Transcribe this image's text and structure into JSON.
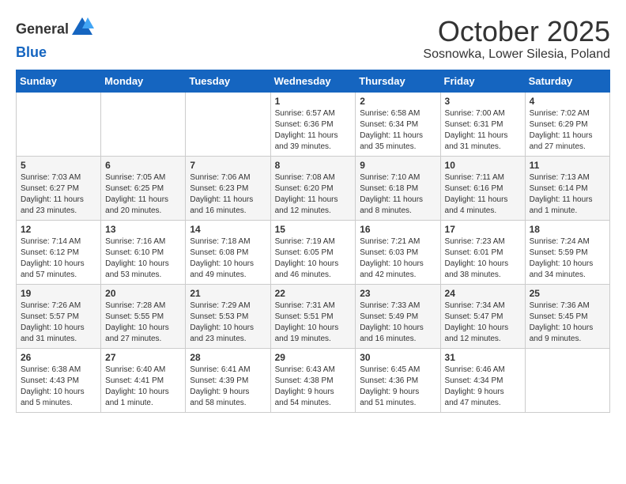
{
  "header": {
    "logo_line1": "General",
    "logo_line2": "Blue",
    "month_title": "October 2025",
    "location": "Sosnowka, Lower Silesia, Poland"
  },
  "days_of_week": [
    "Sunday",
    "Monday",
    "Tuesday",
    "Wednesday",
    "Thursday",
    "Friday",
    "Saturday"
  ],
  "weeks": [
    [
      {
        "day": "",
        "info": ""
      },
      {
        "day": "",
        "info": ""
      },
      {
        "day": "",
        "info": ""
      },
      {
        "day": "1",
        "info": "Sunrise: 6:57 AM\nSunset: 6:36 PM\nDaylight: 11 hours\nand 39 minutes."
      },
      {
        "day": "2",
        "info": "Sunrise: 6:58 AM\nSunset: 6:34 PM\nDaylight: 11 hours\nand 35 minutes."
      },
      {
        "day": "3",
        "info": "Sunrise: 7:00 AM\nSunset: 6:31 PM\nDaylight: 11 hours\nand 31 minutes."
      },
      {
        "day": "4",
        "info": "Sunrise: 7:02 AM\nSunset: 6:29 PM\nDaylight: 11 hours\nand 27 minutes."
      }
    ],
    [
      {
        "day": "5",
        "info": "Sunrise: 7:03 AM\nSunset: 6:27 PM\nDaylight: 11 hours\nand 23 minutes."
      },
      {
        "day": "6",
        "info": "Sunrise: 7:05 AM\nSunset: 6:25 PM\nDaylight: 11 hours\nand 20 minutes."
      },
      {
        "day": "7",
        "info": "Sunrise: 7:06 AM\nSunset: 6:23 PM\nDaylight: 11 hours\nand 16 minutes."
      },
      {
        "day": "8",
        "info": "Sunrise: 7:08 AM\nSunset: 6:20 PM\nDaylight: 11 hours\nand 12 minutes."
      },
      {
        "day": "9",
        "info": "Sunrise: 7:10 AM\nSunset: 6:18 PM\nDaylight: 11 hours\nand 8 minutes."
      },
      {
        "day": "10",
        "info": "Sunrise: 7:11 AM\nSunset: 6:16 PM\nDaylight: 11 hours\nand 4 minutes."
      },
      {
        "day": "11",
        "info": "Sunrise: 7:13 AM\nSunset: 6:14 PM\nDaylight: 11 hours\nand 1 minute."
      }
    ],
    [
      {
        "day": "12",
        "info": "Sunrise: 7:14 AM\nSunset: 6:12 PM\nDaylight: 10 hours\nand 57 minutes."
      },
      {
        "day": "13",
        "info": "Sunrise: 7:16 AM\nSunset: 6:10 PM\nDaylight: 10 hours\nand 53 minutes."
      },
      {
        "day": "14",
        "info": "Sunrise: 7:18 AM\nSunset: 6:08 PM\nDaylight: 10 hours\nand 49 minutes."
      },
      {
        "day": "15",
        "info": "Sunrise: 7:19 AM\nSunset: 6:05 PM\nDaylight: 10 hours\nand 46 minutes."
      },
      {
        "day": "16",
        "info": "Sunrise: 7:21 AM\nSunset: 6:03 PM\nDaylight: 10 hours\nand 42 minutes."
      },
      {
        "day": "17",
        "info": "Sunrise: 7:23 AM\nSunset: 6:01 PM\nDaylight: 10 hours\nand 38 minutes."
      },
      {
        "day": "18",
        "info": "Sunrise: 7:24 AM\nSunset: 5:59 PM\nDaylight: 10 hours\nand 34 minutes."
      }
    ],
    [
      {
        "day": "19",
        "info": "Sunrise: 7:26 AM\nSunset: 5:57 PM\nDaylight: 10 hours\nand 31 minutes."
      },
      {
        "day": "20",
        "info": "Sunrise: 7:28 AM\nSunset: 5:55 PM\nDaylight: 10 hours\nand 27 minutes."
      },
      {
        "day": "21",
        "info": "Sunrise: 7:29 AM\nSunset: 5:53 PM\nDaylight: 10 hours\nand 23 minutes."
      },
      {
        "day": "22",
        "info": "Sunrise: 7:31 AM\nSunset: 5:51 PM\nDaylight: 10 hours\nand 19 minutes."
      },
      {
        "day": "23",
        "info": "Sunrise: 7:33 AM\nSunset: 5:49 PM\nDaylight: 10 hours\nand 16 minutes."
      },
      {
        "day": "24",
        "info": "Sunrise: 7:34 AM\nSunset: 5:47 PM\nDaylight: 10 hours\nand 12 minutes."
      },
      {
        "day": "25",
        "info": "Sunrise: 7:36 AM\nSunset: 5:45 PM\nDaylight: 10 hours\nand 9 minutes."
      }
    ],
    [
      {
        "day": "26",
        "info": "Sunrise: 6:38 AM\nSunset: 4:43 PM\nDaylight: 10 hours\nand 5 minutes."
      },
      {
        "day": "27",
        "info": "Sunrise: 6:40 AM\nSunset: 4:41 PM\nDaylight: 10 hours\nand 1 minute."
      },
      {
        "day": "28",
        "info": "Sunrise: 6:41 AM\nSunset: 4:39 PM\nDaylight: 9 hours\nand 58 minutes."
      },
      {
        "day": "29",
        "info": "Sunrise: 6:43 AM\nSunset: 4:38 PM\nDaylight: 9 hours\nand 54 minutes."
      },
      {
        "day": "30",
        "info": "Sunrise: 6:45 AM\nSunset: 4:36 PM\nDaylight: 9 hours\nand 51 minutes."
      },
      {
        "day": "31",
        "info": "Sunrise: 6:46 AM\nSunset: 4:34 PM\nDaylight: 9 hours\nand 47 minutes."
      },
      {
        "day": "",
        "info": ""
      }
    ]
  ]
}
